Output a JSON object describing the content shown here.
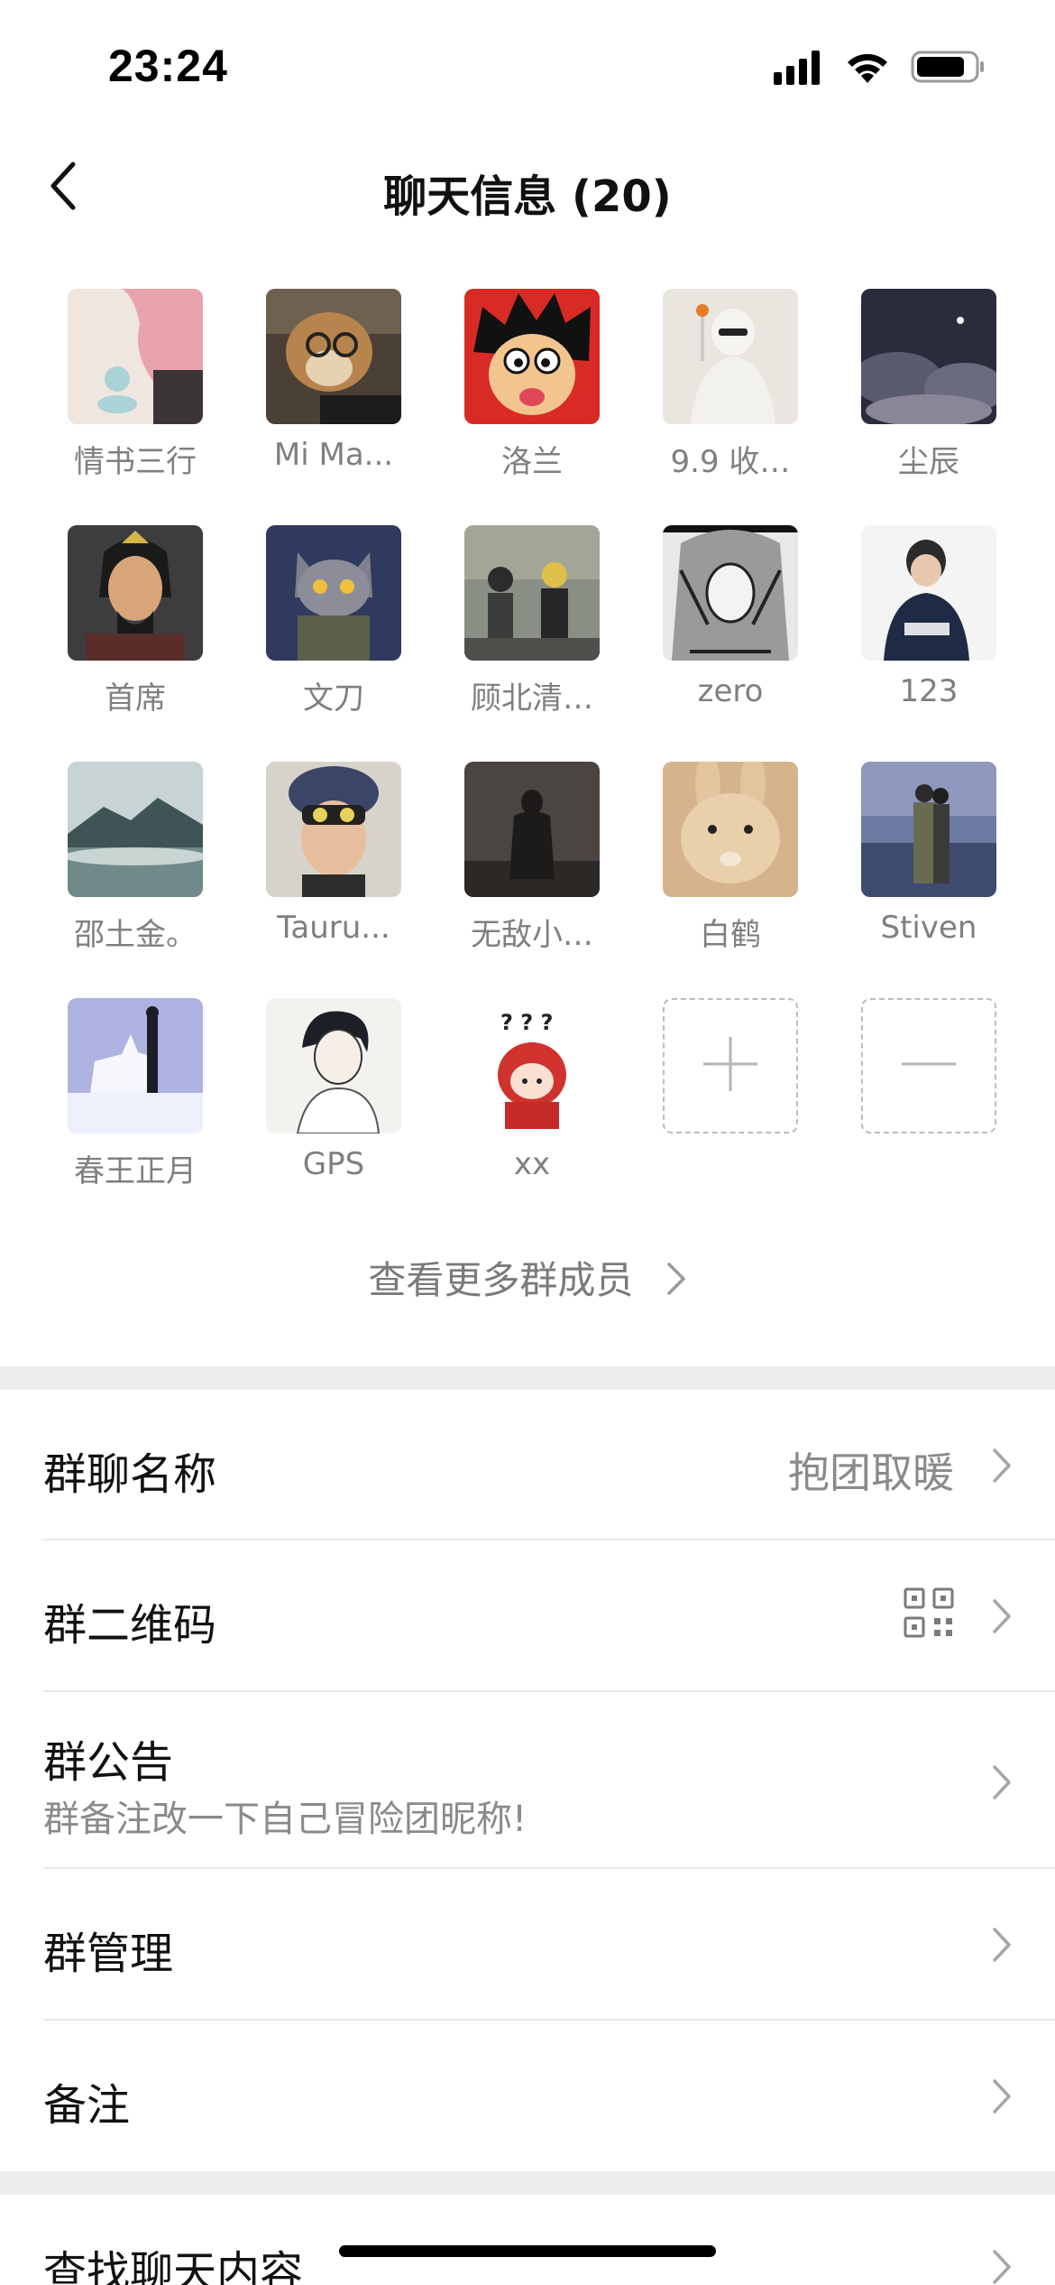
{
  "status_bar": {
    "time": "23:24",
    "icons": [
      "signal-icon",
      "wifi-icon",
      "battery-icon"
    ]
  },
  "nav": {
    "title": "聊天信息 (20)"
  },
  "members": [
    {
      "name": "情书三行",
      "avatar": "pink-hair-sketch"
    },
    {
      "name": "Mi Ma...",
      "avatar": "dog-with-glasses"
    },
    {
      "name": "洛兰",
      "avatar": "cartoon-boy"
    },
    {
      "name": "9.9 收…",
      "avatar": "white-figure"
    },
    {
      "name": "尘辰",
      "avatar": "night-clouds"
    },
    {
      "name": "首席",
      "avatar": "warrior-portrait"
    },
    {
      "name": "文刀",
      "avatar": "armored-cat"
    },
    {
      "name": "顾北清…",
      "avatar": "anime-group"
    },
    {
      "name": "zero",
      "avatar": "ink-drawing"
    },
    {
      "name": "123",
      "avatar": "person-usaf"
    },
    {
      "name": "邵土金。",
      "avatar": "misty-mountain"
    },
    {
      "name": "Tauru...",
      "avatar": "boy-with-goggles"
    },
    {
      "name": "无敌小…",
      "avatar": "dark-figure"
    },
    {
      "name": "白鹤",
      "avatar": "rabbit"
    },
    {
      "name": "Stiven",
      "avatar": "couple-by-sea"
    },
    {
      "name": "春王正月",
      "avatar": "wolf-silhouette"
    },
    {
      "name": "GPS",
      "avatar": "sketch-boy"
    },
    {
      "name": "xx",
      "avatar": "pixel-redhead"
    }
  ],
  "actions": {
    "add": "add-member-button",
    "remove": "remove-member-button"
  },
  "more_members": {
    "label": "查看更多群成员"
  },
  "settings": {
    "group_name": {
      "label": "群聊名称",
      "value": "抱团取暖"
    },
    "qr_code": {
      "label": "群二维码"
    },
    "announcement": {
      "label": "群公告",
      "preview": "群备注改一下自己冒险团昵称!"
    },
    "manage": {
      "label": "群管理"
    },
    "remark": {
      "label": "备注"
    },
    "search": {
      "label": "查找聊天内容"
    }
  },
  "colors": {
    "section_gap": "#ededed",
    "secondary_text": "#8a8a8a",
    "divider": "#e8e8e8"
  }
}
